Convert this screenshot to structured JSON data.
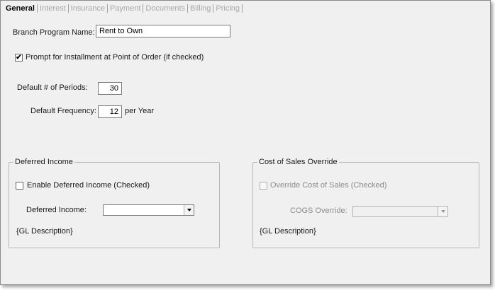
{
  "tabs": [
    {
      "label": "General",
      "active": true
    },
    {
      "label": "Interest",
      "active": false
    },
    {
      "label": "Insurance",
      "active": false
    },
    {
      "label": "Payment",
      "active": false
    },
    {
      "label": "Documents",
      "active": false
    },
    {
      "label": "Billing",
      "active": false
    },
    {
      "label": "Pricing",
      "active": false
    }
  ],
  "general": {
    "branch_program_name_label": "Branch Program Name:",
    "branch_program_name_value": "Rent to Own",
    "prompt_installment_label": "Prompt for Installment at Point of Order (if checked)",
    "prompt_installment_checked": true,
    "check_mark": "✔",
    "default_periods_label": "Default # of Periods:",
    "default_periods_value": "30",
    "default_frequency_label": "Default Frequency:",
    "default_frequency_value": "12",
    "per_year_label": "per Year"
  },
  "deferred_income": {
    "legend": "Deferred Income",
    "enable_label": "Enable Deferred Income (Checked)",
    "enable_checked": false,
    "field_label": "Deferred Income:",
    "selected_value": "",
    "gl_description": "{GL Description}"
  },
  "cost_of_sales": {
    "legend": "Cost of Sales Override",
    "override_label": "Override Cost of Sales (Checked)",
    "override_checked": false,
    "field_label": "COGS Override:",
    "selected_value": "",
    "gl_description": "{GL Description}"
  }
}
